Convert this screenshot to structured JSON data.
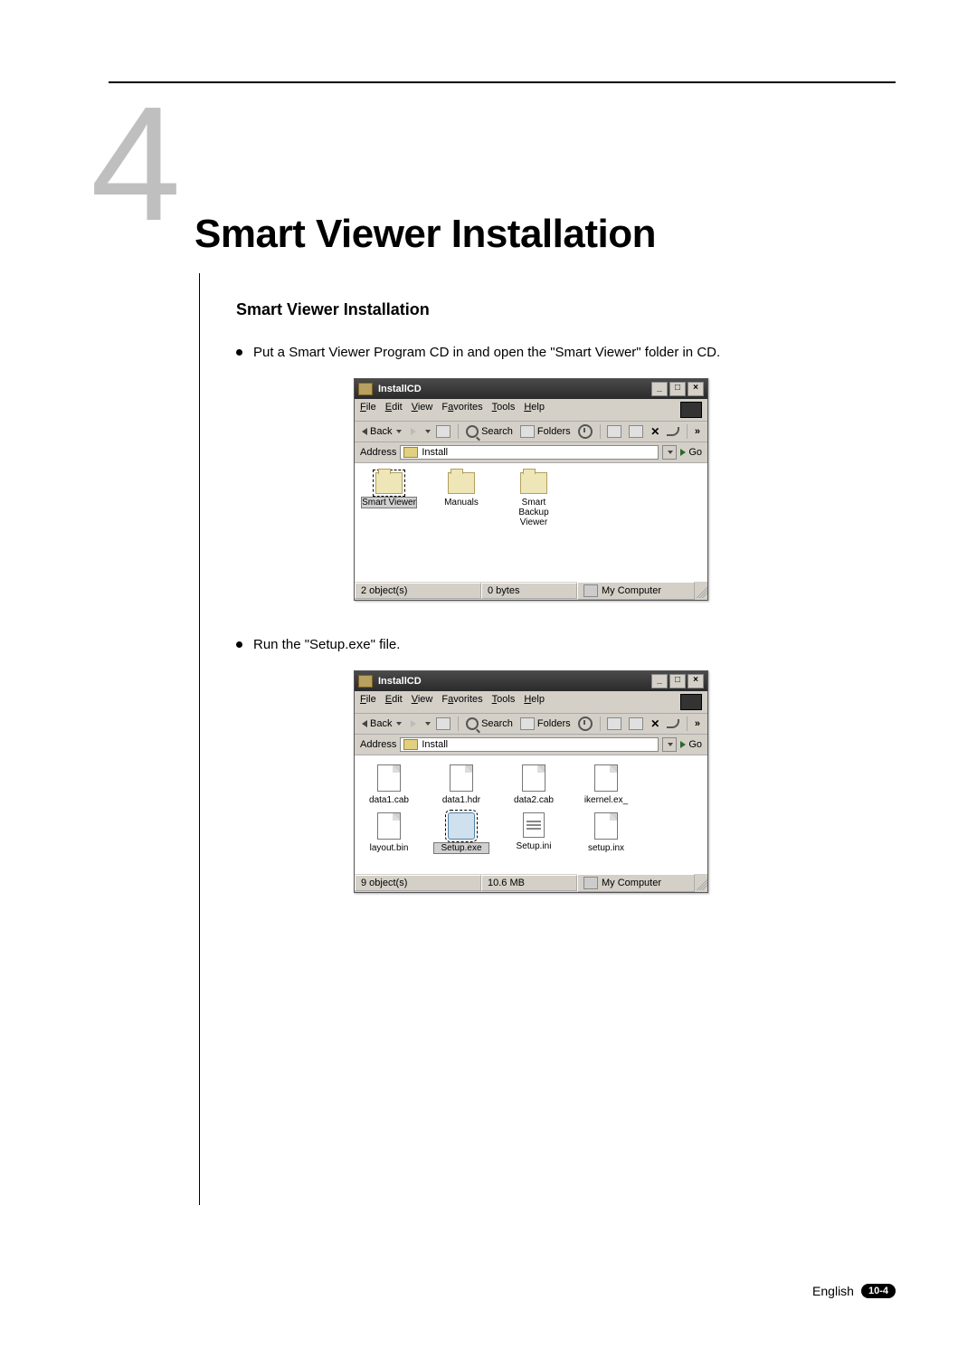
{
  "chapter": {
    "number": "4",
    "title": "Smart Viewer Installation"
  },
  "section_heading": "Smart Viewer Installation",
  "bullets": [
    "Put a Smart Viewer Program CD in and open the \"Smart Viewer\" folder in CD.",
    "Run the \"Setup.exe\" file."
  ],
  "menu": {
    "file": "File",
    "edit": "Edit",
    "view": "View",
    "favorites": "Favorites",
    "tools": "Tools",
    "help": "Help"
  },
  "toolbar": {
    "back": "Back",
    "search": "Search",
    "folders": "Folders"
  },
  "address_label": "Address",
  "go_label": "Go",
  "window1": {
    "title": "InstallCD",
    "address_value": "Install",
    "files": {
      "f0": "Smart Viewer",
      "f1": "Manuals",
      "f2": "Smart Backup Viewer"
    },
    "status_objects": "2 object(s)",
    "status_size": "0 bytes",
    "status_location": "My Computer"
  },
  "window2": {
    "title": "InstallCD",
    "address_value": "Install",
    "files": {
      "f0": "data1.cab",
      "f1": "data1.hdr",
      "f2": "data2.cab",
      "f3": "ikernel.ex_",
      "f4": "layout.bin",
      "f5": "Setup.exe",
      "f6": "Setup.ini",
      "f7": "setup.inx"
    },
    "status_objects": "9 object(s)",
    "status_size": "10.6 MB",
    "status_location": "My Computer"
  },
  "footer": {
    "language": "English",
    "page": "10-4"
  }
}
